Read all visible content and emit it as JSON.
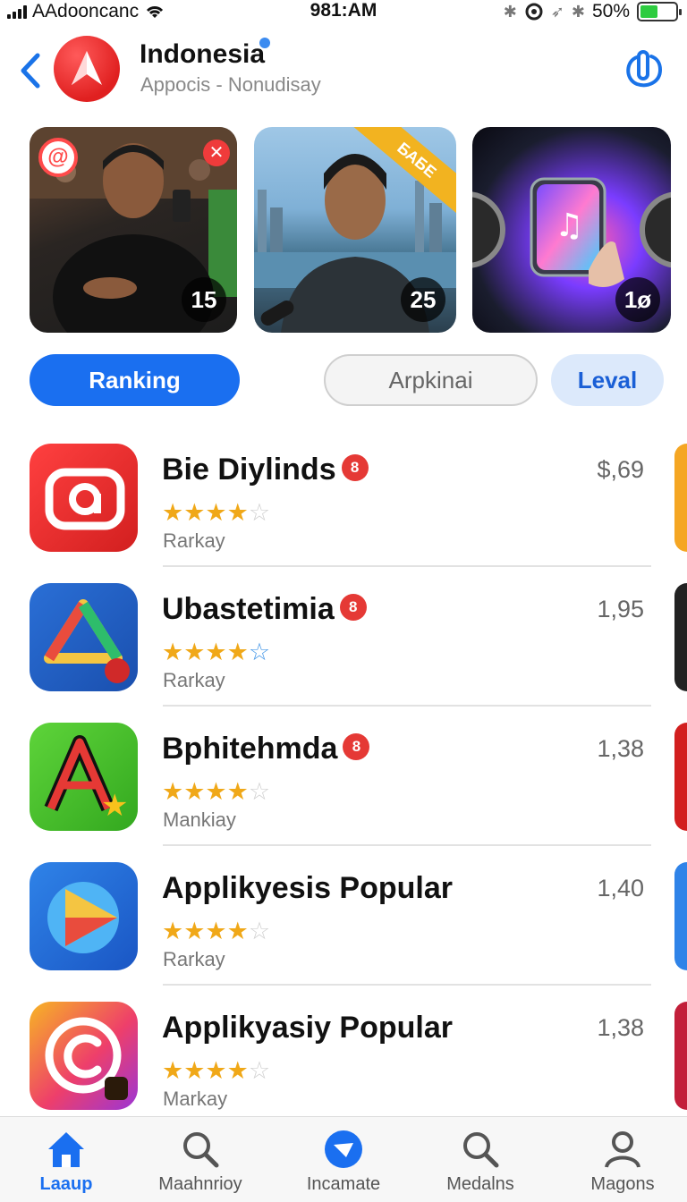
{
  "status_bar": {
    "carrier": "AAdooncanc",
    "time": "981:AM",
    "battery_text": "50%",
    "battery_level": 0.5,
    "colors": {
      "battery": "#2ecc40"
    }
  },
  "header": {
    "title": "Indonesia",
    "subtitle": "Appocis - Nonudisay"
  },
  "banners": [
    {
      "count": "15"
    },
    {
      "count": "25",
      "ribbon": "БАБЕ"
    },
    {
      "count": "1ø"
    }
  ],
  "segments": {
    "ranking": "Ranking",
    "applikasi": "Arpkinai",
    "level": "Leval"
  },
  "apps": [
    {
      "name": "Bie Diylinds",
      "badge": "8",
      "rating": 4,
      "sub": "Rarkay",
      "price": "$,69",
      "icon": "camera-app-icon"
    },
    {
      "name": "Ubastetimia",
      "badge": "8",
      "rating": 4,
      "sub": "Rarkay",
      "price": "1,95",
      "icon": "triangle-app-icon"
    },
    {
      "name": "Bphitehmda",
      "badge": "8",
      "rating": 4,
      "sub": "Mankiay",
      "price": "1,38",
      "icon": "letter-a-app-icon"
    },
    {
      "name": "Applikyesis Popular",
      "badge": "",
      "rating": 4,
      "sub": "Rarkay",
      "price": "1,40",
      "icon": "play-app-icon"
    },
    {
      "name": "Applikyasiy Popular",
      "badge": "",
      "rating": 4,
      "sub": "Markay",
      "price": "1,38",
      "icon": "circle-c-app-icon"
    }
  ],
  "tabbar": {
    "tabs": [
      {
        "label": "Laaup",
        "icon": "home-icon",
        "active": true
      },
      {
        "label": "Maahnrioy",
        "icon": "search-icon",
        "active": false
      },
      {
        "label": "Incamate",
        "icon": "play-circle-icon",
        "active": false
      },
      {
        "label": "Medalns",
        "icon": "search-icon",
        "active": false
      },
      {
        "label": "Magons",
        "icon": "person-icon",
        "active": false
      }
    ]
  },
  "colors": {
    "accent": "#1a6ff0",
    "brand_logo": "#e02020",
    "star": "#f0a818",
    "badge": "#e53935"
  }
}
